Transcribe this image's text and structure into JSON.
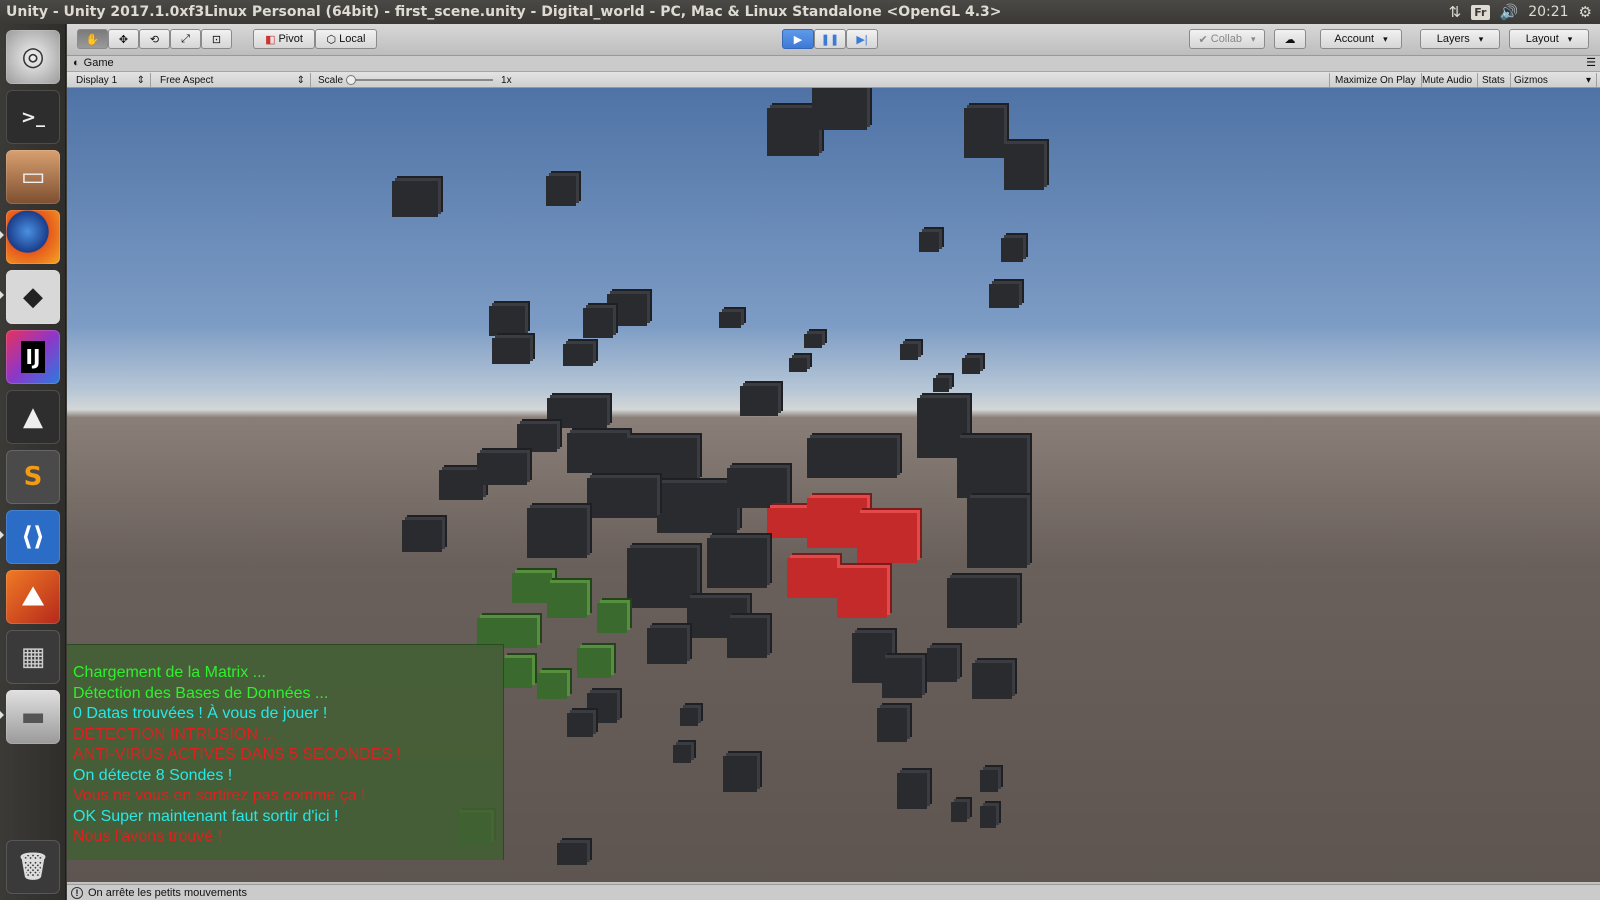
{
  "window_title": "Unity - Unity 2017.1.0xf3Linux Personal (64bit) - first_scene.unity - Digital_world - PC, Mac & Linux Standalone <OpenGL 4.3>",
  "system": {
    "keyboard": "Fr",
    "clock": "20:21"
  },
  "launcher": [
    {
      "name": "ubuntu-dash-icon"
    },
    {
      "name": "terminal-icon"
    },
    {
      "name": "files-icon"
    },
    {
      "name": "firefox-icon"
    },
    {
      "name": "unity-icon"
    },
    {
      "name": "intellij-icon",
      "label": "IJ"
    },
    {
      "name": "inkscape-icon"
    },
    {
      "name": "sublime-text-icon",
      "label": "S"
    },
    {
      "name": "vscode-icon"
    },
    {
      "name": "matlab-icon"
    },
    {
      "name": "workspace-switcher-icon"
    },
    {
      "name": "disk-drive-icon"
    },
    {
      "name": "trash-icon"
    }
  ],
  "toolbar": {
    "pivot": "Pivot",
    "local": "Local",
    "collab": "Collab",
    "account": "Account",
    "layers": "Layers",
    "layout": "Layout"
  },
  "game_tab": {
    "label": "Game"
  },
  "game_bar": {
    "display": "Display 1",
    "aspect": "Free Aspect",
    "scale_label": "Scale",
    "scale_value": "1x",
    "maximize": "Maximize On Play",
    "mute": "Mute Audio",
    "stats": "Stats",
    "gizmos": "Gizmos"
  },
  "console_lines": [
    {
      "text": "Chargement de la Matrix ...",
      "color": "green"
    },
    {
      "text": "Détection des Bases de Données ...",
      "color": "green"
    },
    {
      "text": "0 Datas trouvées ! À vous de jouer !",
      "color": "cyan"
    },
    {
      "text": "DÉTECTION INTRUSION ...",
      "color": "red"
    },
    {
      "text": "ANTI-VIRUS ACTIVÉS DANS 5 SECONDES !",
      "color": "red"
    },
    {
      "text": "On détecte 8 Sondes !",
      "color": "cyan"
    },
    {
      "text": "Vous ne vous en sortirez pas comme ça !",
      "color": "red"
    },
    {
      "text": "OK Super maintenant faut sortir d'ici !",
      "color": "cyan"
    },
    {
      "text": "Nous l'avons trouvé !",
      "color": "red"
    }
  ],
  "status": {
    "message": "On arrête les petits mouvements"
  },
  "colors": {
    "play_blue": "#3d7ad6",
    "sky": "#4f73a6",
    "ground": "#6a605b"
  }
}
